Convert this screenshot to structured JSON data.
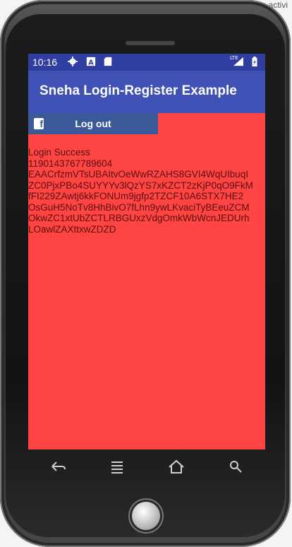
{
  "background": {
    "corner_text": "activi"
  },
  "status_bar": {
    "time": "10:16",
    "icons": [
      "gear-icon",
      "a-notification-icon",
      "sd-card-icon",
      "lte-signal-icon",
      "battery-icon"
    ],
    "lte_label": "LTE"
  },
  "app_bar": {
    "title": "Sneha Login-Register Example"
  },
  "facebook_button": {
    "label": "Log out",
    "icon": "facebook-f-icon",
    "color": "#3b5998"
  },
  "content": {
    "lines": [
      "Login Success",
      "1190143767789604",
      "EAACrfzmVTsUBAItvOeWwRZAHS8GVI4WqUIbuqI",
      "ZC0PjxPBo4SUYYYv3lQzYS7xKZCT2zKjP0qO9FkM",
      "fFI229ZAwtj6kkFONUm9jgfp2TZCF10A6STX7HE2",
      "OsGuH5NoTv8HhBivO7fLhn9ywLKvaciTyBEeuZCM",
      "OkwZC1xtUbZCTLRBGUxzVdgOmkWbWcnJEDUrh",
      "LOawlZAXttxwZDZD"
    ]
  },
  "nav_keys": {
    "back": "back-icon",
    "menu": "menu-icon",
    "home": "home-icon",
    "search": "search-icon"
  },
  "colors": {
    "screen_background": "#ff4444",
    "app_bar": "#3f51b5",
    "status_bar": "#303f9f",
    "content_text": "#5a1010"
  }
}
